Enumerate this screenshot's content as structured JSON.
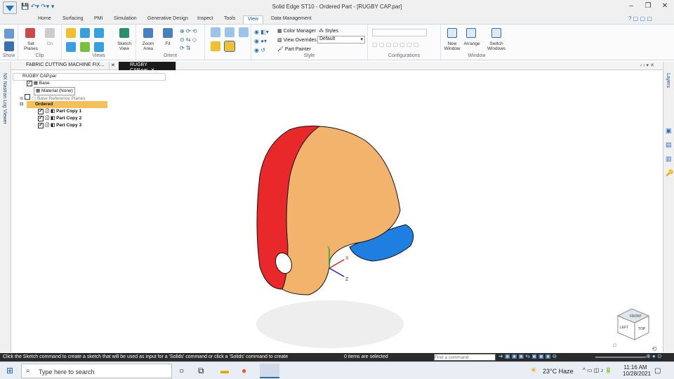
{
  "window": {
    "title": "Solid Edge ST10 - Ordered Part - [RUGBY CAP.par]",
    "tabs": [
      "Home",
      "Surfacing",
      "PMI",
      "Simulation",
      "Generative Design",
      "Inspect",
      "Tools",
      "View",
      "Data Management"
    ],
    "active_tab": "View"
  },
  "ribbon": {
    "show": {
      "label": "Show"
    },
    "clip": {
      "label": "Clip",
      "set_planes": "Set Planes",
      "on": "On"
    },
    "views": {
      "label": "Views",
      "sketch_view": "Sketch View"
    },
    "orient": {
      "label": "Orient",
      "zoom_area": "Zoom Area",
      "fit": "Fit"
    },
    "style": {
      "label": "Style",
      "color_manager": "Color Manager",
      "styles": "Styles",
      "view_overrides": "View Overrides",
      "override_value": "Default",
      "part_painter": "Part Painter"
    },
    "configurations": {
      "label": "Configurations"
    },
    "window": {
      "label": "Window",
      "new_window": "New Window",
      "arrange": "Arrange",
      "switch_windows": "Switch Windows"
    }
  },
  "side": {
    "left": "NX Nastran Log Viewer",
    "right": "Layers"
  },
  "docs": {
    "tabs": [
      "FABRIC CUTTING MACHINE FIX...",
      "RUGBY CAP.par"
    ]
  },
  "tree": {
    "root": "RUGBY CAP.par",
    "base": "Base",
    "material": "Material (None)",
    "ref_planes": "Base Reference Planes",
    "ordered": "Ordered",
    "items": [
      "Part Copy 1",
      "Part Copy 2",
      "Part Copy 3"
    ]
  },
  "viewcube": {
    "top": "TOP",
    "front": "FRONT",
    "left": "LEFT"
  },
  "status": {
    "prompt": "Click the Sketch command to create a sketch that will be used as input for a 'Solids' command or click a 'Solids' command to create",
    "selection": "0 items are selected",
    "command_placeholder": "Find a command"
  },
  "taskbar": {
    "search": "Type here to search",
    "temp": "23°C",
    "weather": "Haze",
    "time": "11:16 AM",
    "date": "10/28/2021"
  },
  "colors": {
    "cap_shell": "#f2b36c",
    "cap_side": "#e8282a",
    "cap_brim": "#1f7fe0"
  }
}
